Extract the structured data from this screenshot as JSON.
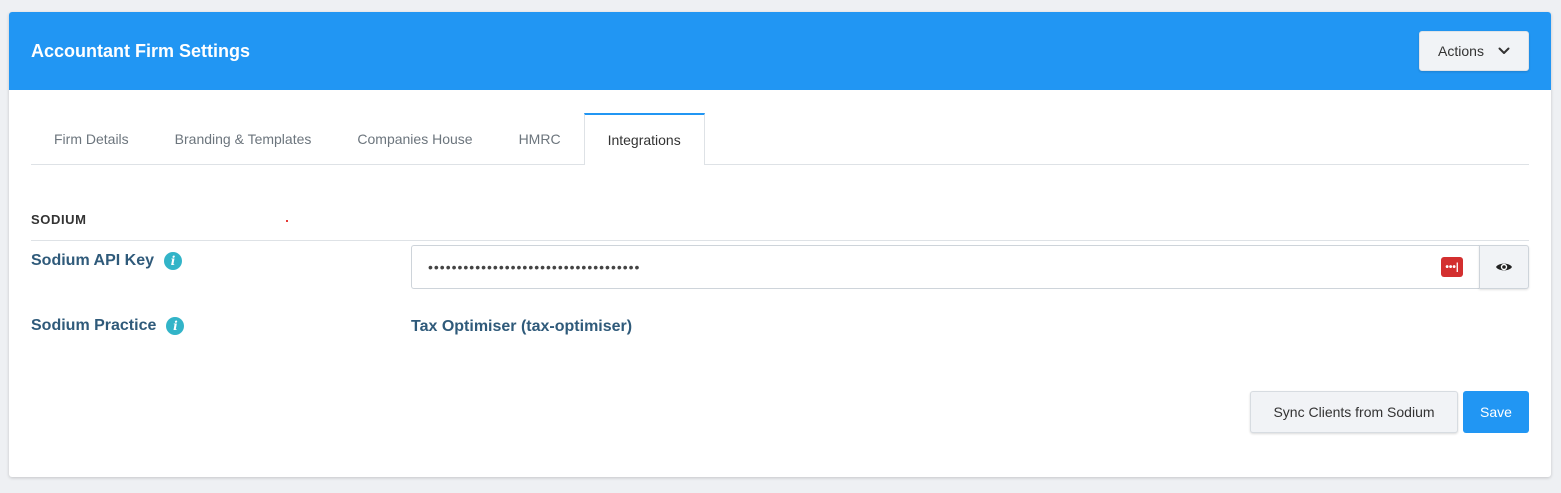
{
  "header": {
    "title": "Accountant Firm Settings",
    "actions_label": "Actions",
    "brand_color": "#2196f3"
  },
  "tabs": [
    {
      "label": "Firm Details",
      "active": false
    },
    {
      "label": "Branding & Templates",
      "active": false
    },
    {
      "label": "Companies House",
      "active": false
    },
    {
      "label": "HMRC",
      "active": false
    },
    {
      "label": "Integrations",
      "active": true
    }
  ],
  "section": {
    "title": "SODIUM"
  },
  "fields": {
    "api_key": {
      "label": "Sodium API Key",
      "value": "••••••••••••••••••••••••••••••••••••",
      "badge": "•••|"
    },
    "practice": {
      "label": "Sodium Practice",
      "value": "Tax Optimiser (tax-optimiser)"
    }
  },
  "buttons": {
    "sync_label": "Sync Clients from Sodium",
    "save_label": "Save"
  },
  "icons": {
    "info": "info-icon",
    "eye": "eye-icon",
    "chevron": "chevron-down-icon"
  }
}
